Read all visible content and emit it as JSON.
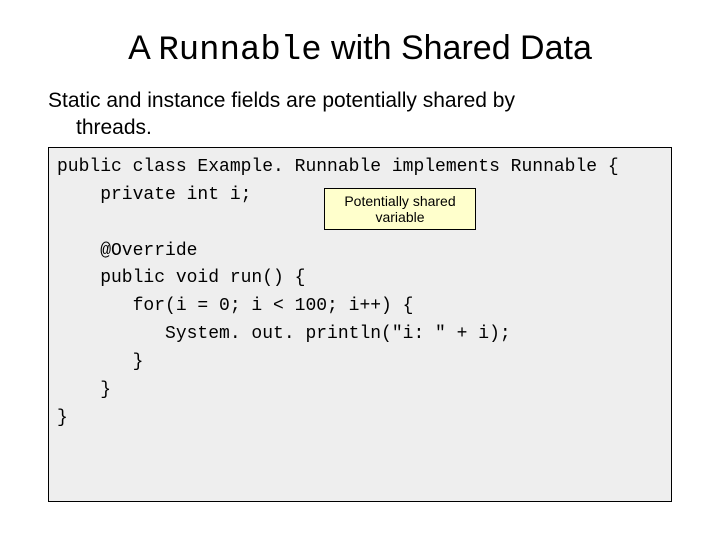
{
  "title": {
    "prefix": "A ",
    "mono": "Runnable",
    "suffix": " with Shared Data"
  },
  "intro": {
    "line1": "Static and instance fields are potentially shared by",
    "line2": "threads."
  },
  "code": {
    "l1": "public class Example. Runnable implements Runnable {",
    "l2": "    private int i;",
    "l3": "",
    "l4": "    @Override",
    "l5": "    public void run() {",
    "l6": "       for(i = 0; i < 100; i++) {",
    "l7": "          System. out. println(\"i: \" + i);",
    "l8": "       }",
    "l9": "    }",
    "l10": "}"
  },
  "callout": {
    "text": "Potentially shared variable"
  }
}
